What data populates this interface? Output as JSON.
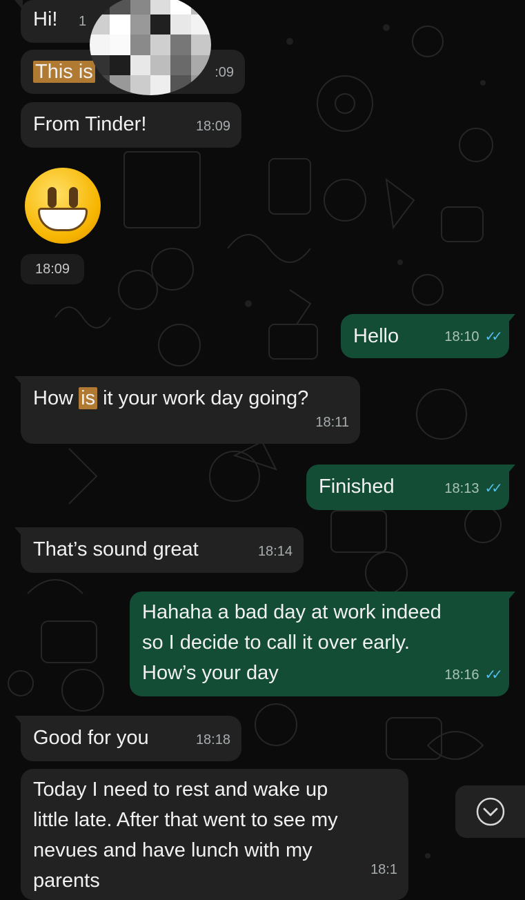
{
  "messages": [
    {
      "text": "Hi!",
      "time": "1"
    },
    {
      "text_before": "This ",
      "highlight": "is",
      "time": ":09"
    },
    {
      "text": "From Tinder!",
      "time": "18:09"
    },
    {
      "time": "18:09"
    },
    {
      "text": "Hello",
      "time": "18:10"
    },
    {
      "text_before": "How ",
      "highlight": "is",
      "text_after": " it your work day going?",
      "time": "18:11"
    },
    {
      "text": "Finished",
      "time": "18:13"
    },
    {
      "text": "That’s sound great",
      "time": "18:14"
    },
    {
      "line1": "Hahaha a bad day at work indeed",
      "line2": "so I decide to call it over early.",
      "line3": "How’s your day",
      "time": "18:16"
    },
    {
      "text": "Good for you",
      "time": "18:18"
    },
    {
      "line1": "Today I need to rest and wake up",
      "line2": "little late. After that went to see my",
      "line3": "nevues and have lunch with my",
      "line4": "parents",
      "time": "18:1"
    }
  ],
  "colors": {
    "background": "#0b0b0b",
    "incoming_bubble": "#222222",
    "outgoing_bubble": "#134d36",
    "read_ticks": "#53bdeb",
    "highlight": "#b07a33"
  },
  "icons": {
    "read_receipt": "double-check-icon",
    "scroll_down": "chevron-down-circle-icon"
  }
}
